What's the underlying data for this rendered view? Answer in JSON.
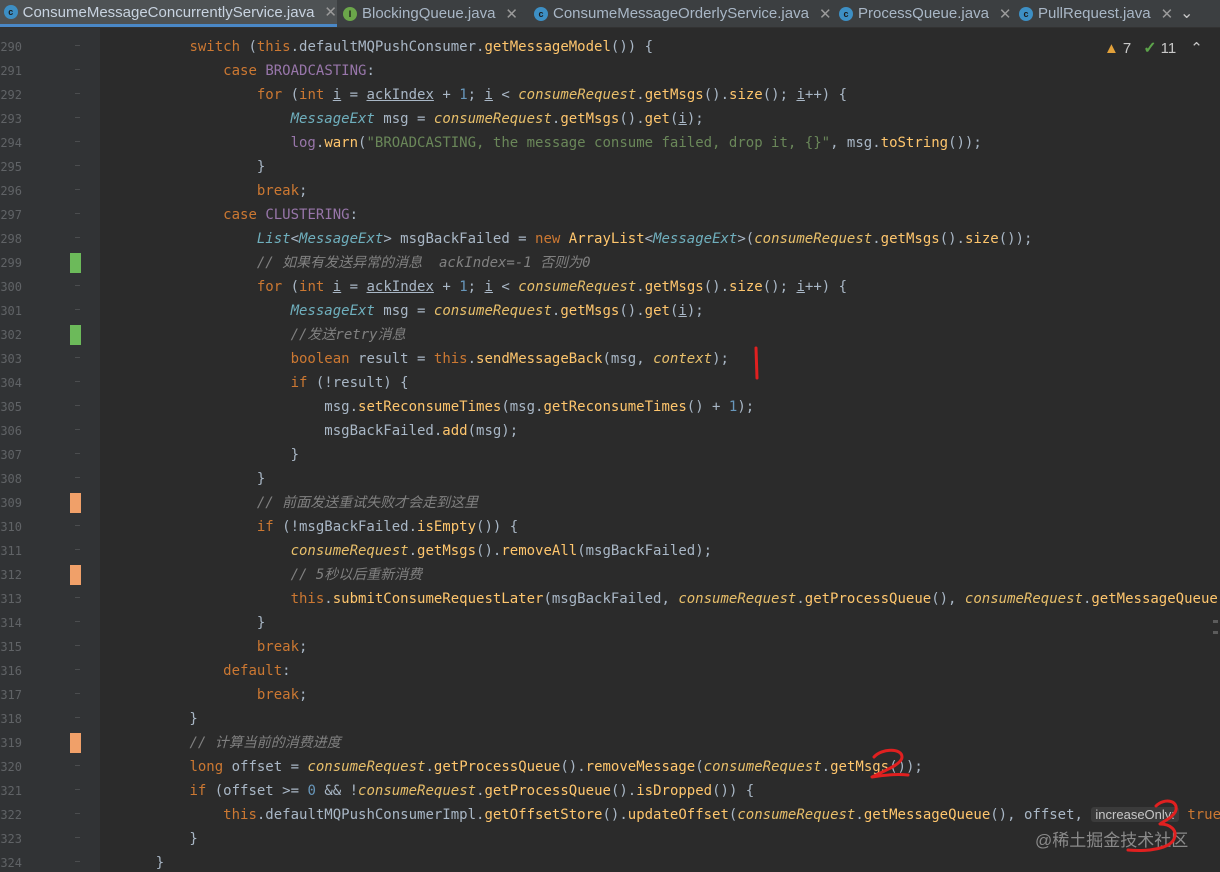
{
  "tabs": [
    {
      "label": "ConsumeMessageConcurrentlyService.java",
      "icon": "class-icon",
      "active": true,
      "closable": true
    },
    {
      "label": "BlockingQueue.java",
      "icon": "interface-icon",
      "active": false,
      "closable": true
    },
    {
      "label": "ConsumeMessageOrderlyService.java",
      "icon": "class-icon",
      "active": false,
      "closable": true
    },
    {
      "label": "ProcessQueue.java",
      "icon": "class-icon",
      "active": false,
      "closable": true
    },
    {
      "label": "PullRequest.java",
      "icon": "class-icon",
      "active": false,
      "closable": true
    }
  ],
  "tab_menu_icon": "chevron-down-icon",
  "inspections": {
    "warnings": "7",
    "ok": "11"
  },
  "colors": {
    "green_change": "#6cba5a",
    "orange_change": "#f0a069",
    "annotation_red": "#e02020",
    "accent": "#4a88c7"
  },
  "lines": [
    {
      "num": "290",
      "mark": "",
      "html": "        <span class='kw'>switch</span> (<span class='kw'>this</span>.defaultMQPushConsumer.<span class='fn'>getMessageModel</span>()) {"
    },
    {
      "num": "291",
      "mark": "",
      "html": "            <span class='kw'>case</span> <span class='fld'>BROADCASTING</span>:"
    },
    {
      "num": "292",
      "mark": "",
      "html": "                <span class='kw'>for</span> (<span class='kw'>int</span> <span class='ul'>i</span> = <span class='ul'>ackIndex</span> + <span class='num'>1</span>; <span class='ul'>i</span> &lt; <span class='ital'>consumeRequest</span>.<span class='fn'>getMsgs</span>().<span class='fn'>size</span>(); <span class='ul'>i</span>++) {"
    },
    {
      "num": "293",
      "mark": "",
      "html": "                    <span class='type'>MessageExt</span> msg = <span class='ital'>consumeRequest</span>.<span class='fn'>getMsgs</span>().<span class='fn'>get</span>(<span class='ul'>i</span>);"
    },
    {
      "num": "294",
      "mark": "",
      "html": "                    <span class='fld'>log</span>.<span class='fn'>warn</span>(<span class='str'>\"BROADCASTING, the message consume failed, drop it, {}\"</span>, msg.<span class='fn'>toString</span>());"
    },
    {
      "num": "295",
      "mark": "",
      "html": "                }"
    },
    {
      "num": "296",
      "mark": "",
      "html": "                <span class='kw'>break</span>;"
    },
    {
      "num": "297",
      "mark": "",
      "html": "            <span class='kw'>case</span> <span class='fld'>CLUSTERING</span>:"
    },
    {
      "num": "298",
      "mark": "",
      "html": "                <span class='type'>List</span>&lt;<span class='type'>MessageExt</span>&gt; msgBackFailed = <span class='kw'>new</span> <span class='fn'>ArrayList</span>&lt;<span class='type'>MessageExt</span>&gt;(<span class='ital'>consumeRequest</span>.<span class='fn'>getMsgs</span>().<span class='fn'>size</span>());"
    },
    {
      "num": "299",
      "mark": "green",
      "html": "                <span class='cm'>// 如果有发送异常的消息  ackIndex=-1 否则为0</span>"
    },
    {
      "num": "300",
      "mark": "",
      "html": "                <span class='kw'>for</span> (<span class='kw'>int</span> <span class='ul'>i</span> = <span class='ul'>ackIndex</span> + <span class='num'>1</span>; <span class='ul'>i</span> &lt; <span class='ital'>consumeRequest</span>.<span class='fn'>getMsgs</span>().<span class='fn'>size</span>(); <span class='ul'>i</span>++) {"
    },
    {
      "num": "301",
      "mark": "",
      "html": "                    <span class='type'>MessageExt</span> msg = <span class='ital'>consumeRequest</span>.<span class='fn'>getMsgs</span>().<span class='fn'>get</span>(<span class='ul'>i</span>);"
    },
    {
      "num": "302",
      "mark": "green",
      "html": "                    <span class='cm'>//发送retry消息</span>"
    },
    {
      "num": "303",
      "mark": "",
      "html": "                    <span class='kw'>boolean</span> result = <span class='kw'>this</span>.<span class='fn'>sendMessageBack</span>(msg, <span class='ital'>context</span>);"
    },
    {
      "num": "304",
      "mark": "",
      "html": "                    <span class='kw'>if</span> (!result) {"
    },
    {
      "num": "305",
      "mark": "",
      "html": "                        msg.<span class='fn'>setReconsumeTimes</span>(msg.<span class='fn'>getReconsumeTimes</span>() + <span class='num'>1</span>);"
    },
    {
      "num": "306",
      "mark": "",
      "html": "                        msgBackFailed.<span class='fn'>add</span>(msg);"
    },
    {
      "num": "307",
      "mark": "",
      "html": "                    }"
    },
    {
      "num": "308",
      "mark": "",
      "html": "                }"
    },
    {
      "num": "309",
      "mark": "orange",
      "html": "                <span class='cm'>// 前面发送重试失败才会走到这里</span>"
    },
    {
      "num": "310",
      "mark": "",
      "html": "                <span class='kw'>if</span> (!msgBackFailed.<span class='fn'>isEmpty</span>()) {"
    },
    {
      "num": "311",
      "mark": "",
      "html": "                    <span class='ital'>consumeRequest</span>.<span class='fn'>getMsgs</span>().<span class='fn'>removeAll</span>(msgBackFailed);"
    },
    {
      "num": "312",
      "mark": "orange",
      "html": "                    <span class='cm'>// 5秒以后重新消费</span>"
    },
    {
      "num": "313",
      "mark": "",
      "html": "                    <span class='kw'>this</span>.<span class='fn'>submitConsumeRequestLater</span>(msgBackFailed, <span class='ital'>consumeRequest</span>.<span class='fn'>getProcessQueue</span>(), <span class='ital'>consumeRequest</span>.<span class='fn'>getMessageQueue</span>());"
    },
    {
      "num": "314",
      "mark": "",
      "html": "                }"
    },
    {
      "num": "315",
      "mark": "",
      "html": "                <span class='kw'>break</span>;"
    },
    {
      "num": "316",
      "mark": "",
      "html": "            <span class='kw'>default</span>:"
    },
    {
      "num": "317",
      "mark": "",
      "html": "                <span class='kw'>break</span>;"
    },
    {
      "num": "318",
      "mark": "",
      "html": "        }"
    },
    {
      "num": "319",
      "mark": "orange",
      "html": "        <span class='cm'>// 计算当前的消费进度</span>"
    },
    {
      "num": "320",
      "mark": "",
      "html": "        <span class='kw'>long</span> offset = <span class='ital'>consumeRequest</span>.<span class='fn'>getProcessQueue</span>().<span class='fn'>removeMessage</span>(<span class='ital'>consumeRequest</span>.<span class='fn'>getMsgs</span>());"
    },
    {
      "num": "321",
      "mark": "",
      "html": "        <span class='kw'>if</span> (offset &gt;= <span class='num'>0</span> &amp;&amp; !<span class='ital'>consumeRequest</span>.<span class='fn'>getProcessQueue</span>().<span class='fn'>isDropped</span>()) {"
    },
    {
      "num": "322",
      "mark": "",
      "html": "            <span class='kw'>this</span>.defaultMQPushConsumerImpl.<span class='fn'>getOffsetStore</span>().<span class='fn'>updateOffset</span>(<span class='ital'>consumeRequest</span>.<span class='fn'>getMessageQueue</span>(), offset, <span class='hint'>increaseOnly:</span> <span class='kw'>true</span>);"
    },
    {
      "num": "323",
      "mark": "",
      "html": "        }"
    },
    {
      "num": "324",
      "mark": "",
      "html": "    }"
    }
  ],
  "watermark": "@稀土掘金技术社区"
}
